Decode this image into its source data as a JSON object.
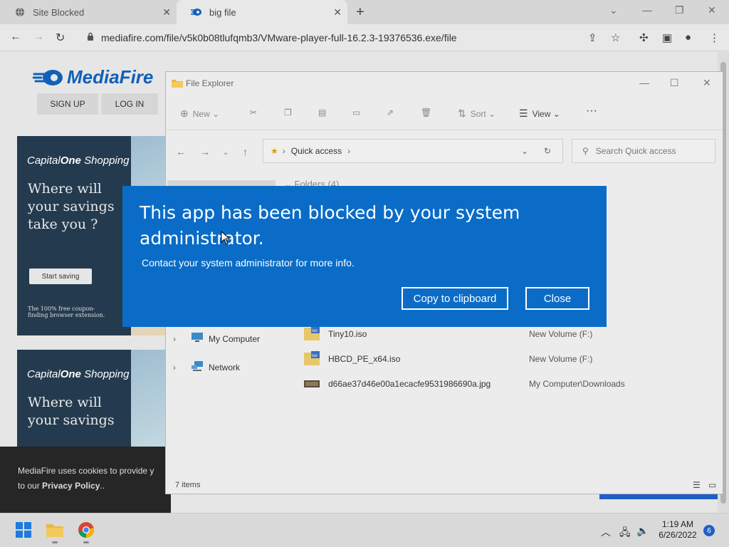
{
  "browser": {
    "tabs": [
      {
        "label": "Site Blocked"
      },
      {
        "label": "big file"
      }
    ],
    "new_tab": "+",
    "url": "mediafire.com/file/v5k0b08tlufqmb3/VMware-player-full-16.2.3-19376536.exe/file"
  },
  "mediafire": {
    "logo": "MediaFire",
    "signup": "SIGN UP",
    "login": "LOG IN",
    "ads": [
      {
        "brand": "Capital",
        "brand2": "One",
        "brand3": "Shopping",
        "headline": "Where will your savings take you ?",
        "cta": "Start saving",
        "fine": "The 100% free coupon-finding browser extension."
      },
      {
        "brand": "Capital",
        "brand2": "One",
        "brand3": "Shopping",
        "headline": "Where will your savings"
      }
    ],
    "cookie_text_1": "MediaFire uses cookies to provide y",
    "cookie_text_2": "to our ",
    "cookie_link": "Privacy Policy",
    "cookie_end": ".."
  },
  "explorer": {
    "title": "File Explorer",
    "commands": {
      "new": "New",
      "sort": "Sort",
      "view": "View",
      "more": "···"
    },
    "path_label": "Quick access",
    "search_placeholder": "Search Quick access",
    "folders_header": "Folders (4)",
    "tree": [
      {
        "label": "My Computer"
      },
      {
        "label": "Network"
      }
    ],
    "files": [
      {
        "name": "Tiny10.iso",
        "location": "New Volume (F:)"
      },
      {
        "name": "HBCD_PE_x64.iso",
        "location": "New Volume (F:)"
      },
      {
        "name": "d66ae37d46e00a1ecacfe9531986690a.jpg",
        "location": "My Computer\\Downloads"
      }
    ],
    "status": "7 items"
  },
  "dialog": {
    "title": "This app has been blocked by your system administrator.",
    "subtitle": "Contact your system administrator for more info.",
    "copy_button": "Copy to clipboard",
    "close_button": "Close",
    "accent": "#0a6cc7"
  },
  "taskbar": {
    "time": "1:19 AM",
    "date": "6/26/2022",
    "notifications": "6"
  }
}
